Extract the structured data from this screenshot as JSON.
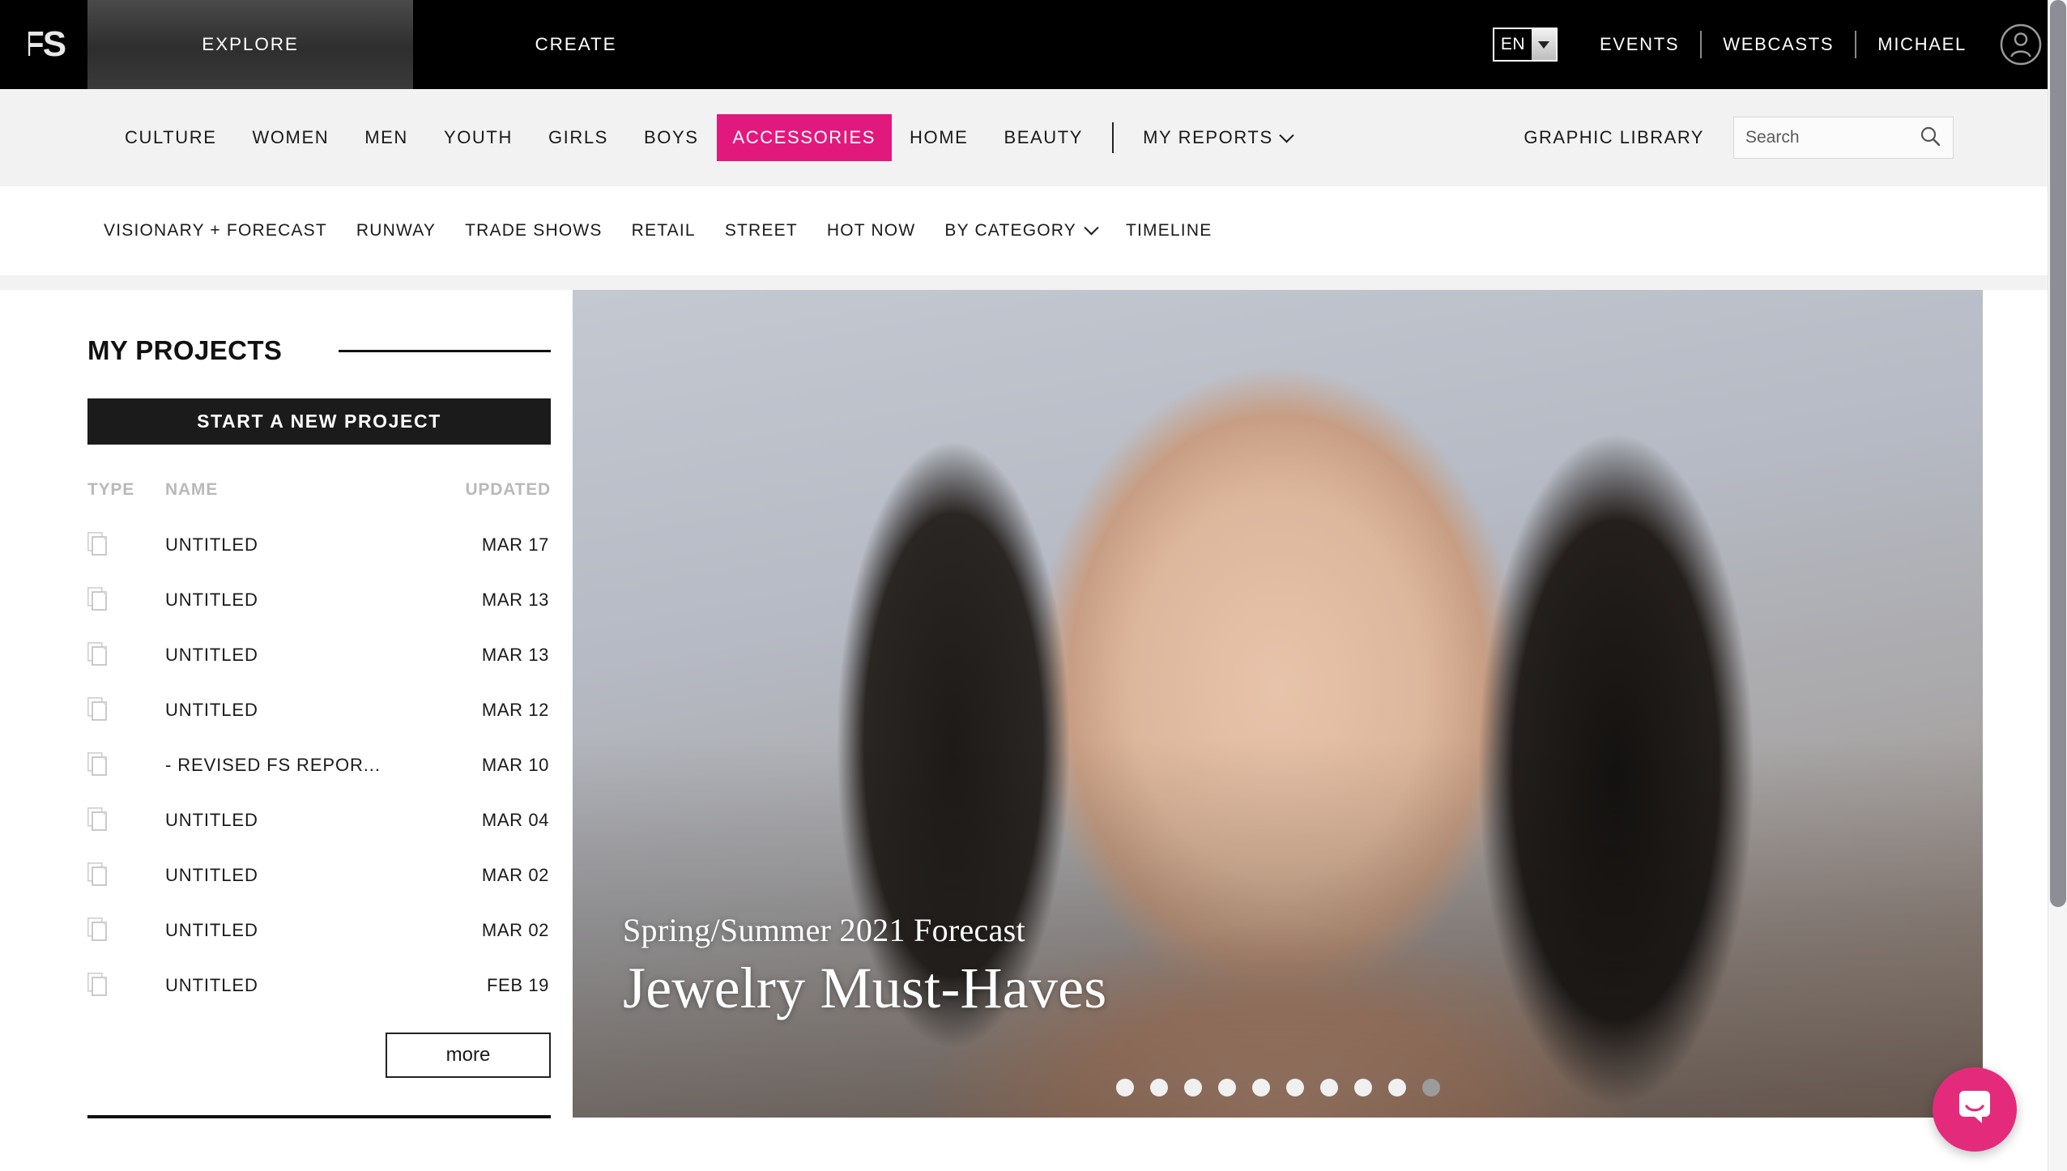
{
  "brand": {
    "logo_text": "FS",
    "accent_pink": "#E2197D",
    "chat_pink": "#E42B7B"
  },
  "topbar": {
    "nav": [
      {
        "label": "EXPLORE",
        "active": true
      },
      {
        "label": "CREATE",
        "active": false
      }
    ],
    "language": "EN",
    "links": [
      "EVENTS",
      "WEBCASTS"
    ],
    "user_name": "MICHAEL",
    "avatar_icon": "user-avatar-icon"
  },
  "mainnav": {
    "items": [
      {
        "label": "CULTURE",
        "highlight": false
      },
      {
        "label": "WOMEN",
        "highlight": false
      },
      {
        "label": "MEN",
        "highlight": false
      },
      {
        "label": "YOUTH",
        "highlight": false
      },
      {
        "label": "GIRLS",
        "highlight": false
      },
      {
        "label": "BOYS",
        "highlight": false
      },
      {
        "label": "ACCESSORIES",
        "highlight": true
      },
      {
        "label": "HOME",
        "highlight": false
      },
      {
        "label": "BEAUTY",
        "highlight": false
      }
    ],
    "my_reports": "MY REPORTS",
    "graphic_library": "GRAPHIC LIBRARY",
    "search": {
      "value": "",
      "placeholder": "Search",
      "icon": "search-icon"
    }
  },
  "subnav": {
    "items": [
      {
        "label": "VISIONARY + FORECAST",
        "has_chevron": false
      },
      {
        "label": "RUNWAY",
        "has_chevron": false
      },
      {
        "label": "TRADE SHOWS",
        "has_chevron": false
      },
      {
        "label": "RETAIL",
        "has_chevron": false
      },
      {
        "label": "STREET",
        "has_chevron": false
      },
      {
        "label": "HOT NOW",
        "has_chevron": false
      },
      {
        "label": "BY CATEGORY",
        "has_chevron": true
      },
      {
        "label": "TIMELINE",
        "has_chevron": false
      }
    ]
  },
  "sidebar": {
    "title": "MY PROJECTS",
    "new_project_label": "START A NEW PROJECT",
    "columns": {
      "type": "TYPE",
      "name": "NAME",
      "updated": "UPDATED"
    },
    "rows": [
      {
        "icon": "documents-icon",
        "name": "UNTITLED",
        "updated": "MAR 17"
      },
      {
        "icon": "documents-icon",
        "name": "UNTITLED",
        "updated": "MAR 13"
      },
      {
        "icon": "documents-icon",
        "name": "UNTITLED",
        "updated": "MAR 13"
      },
      {
        "icon": "documents-icon",
        "name": "UNTITLED",
        "updated": "MAR 12"
      },
      {
        "icon": "documents-icon",
        "name": "- REVISED FS REPOR...",
        "updated": "MAR 10"
      },
      {
        "icon": "documents-icon",
        "name": "UNTITLED",
        "updated": "MAR 04"
      },
      {
        "icon": "documents-icon",
        "name": "UNTITLED",
        "updated": "MAR 02"
      },
      {
        "icon": "documents-icon",
        "name": "UNTITLED",
        "updated": "MAR 02"
      },
      {
        "icon": "documents-icon",
        "name": "UNTITLED",
        "updated": "FEB 19"
      }
    ],
    "more_label": "more"
  },
  "hero": {
    "kicker": "Spring/Summer 2021 Forecast",
    "title": "Jewelry Must-Haves",
    "dots_total": 10,
    "dots_current_index": 9
  },
  "chat": {
    "icon": "chat-bubble-smiley-icon"
  }
}
